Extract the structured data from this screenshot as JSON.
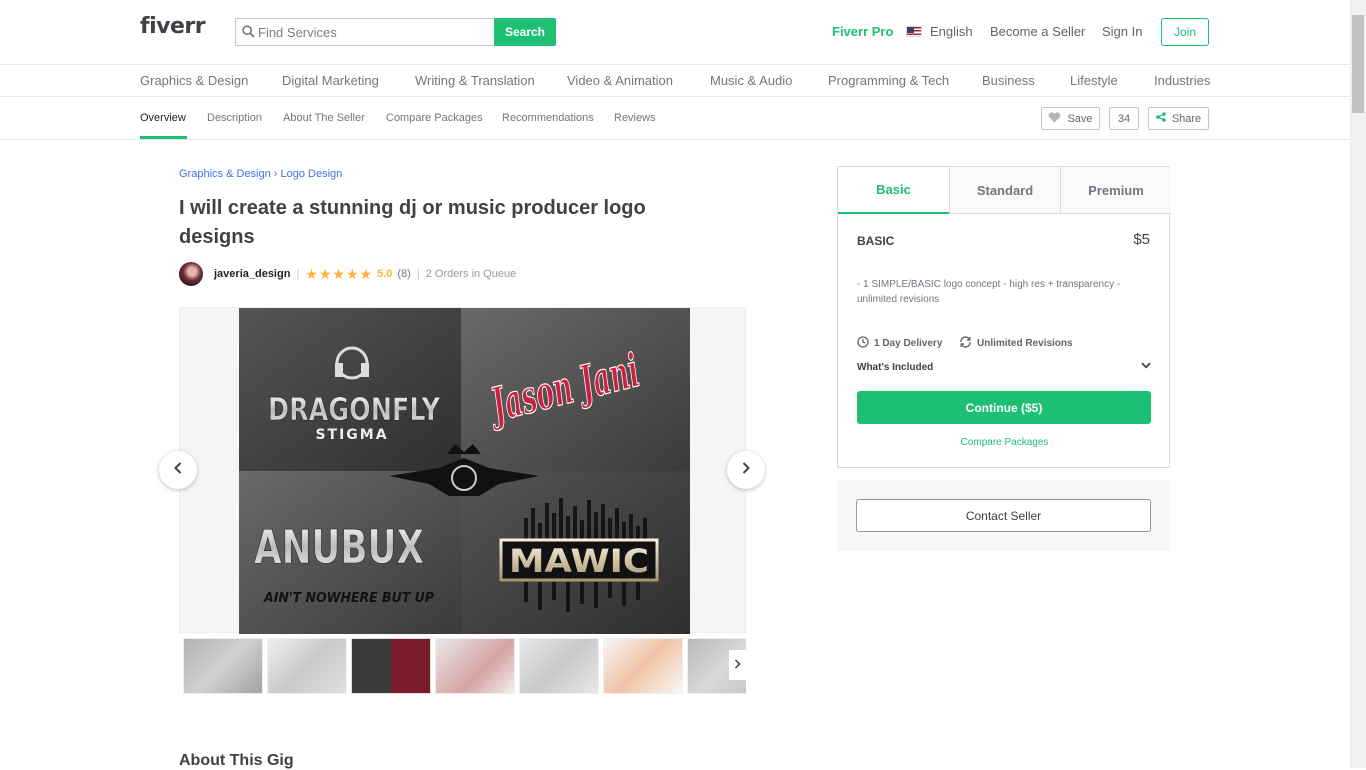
{
  "header": {
    "logo": "fiverr",
    "search_placeholder": "Find Services",
    "search_button": "Search",
    "fiverr_pro": "Fiverr Pro",
    "language": "English",
    "become_seller": "Become a Seller",
    "sign_in": "Sign In",
    "join": "Join"
  },
  "categories": [
    "Graphics & Design",
    "Digital Marketing",
    "Writing & Translation",
    "Video & Animation",
    "Music & Audio",
    "Programming & Tech",
    "Business",
    "Lifestyle",
    "Industries"
  ],
  "subnav": {
    "items": [
      "Overview",
      "Description",
      "About The Seller",
      "Compare Packages",
      "Recommendations",
      "Reviews"
    ],
    "active": "Overview",
    "save": "Save",
    "save_count": "34",
    "share": "Share"
  },
  "breadcrumb": {
    "category": "Graphics & Design",
    "separator": "›",
    "subcategory": "Logo Design"
  },
  "gig": {
    "title": "I will create a stunning dj or music producer logo designs",
    "seller": "javeria_design",
    "rating": "5.0",
    "rating_count": "(8)",
    "stars": 5,
    "queue": "2 Orders in Queue",
    "about_heading": "About This Gig"
  },
  "gallery": {
    "logos": [
      "DRAGONFLY",
      "STIGMA",
      "Jason Jani",
      "ANUBUX",
      "AIN'T NOWHERE BUT UP",
      "MAWIC"
    ],
    "thumbnail_count": 7,
    "active_thumbnail": 3
  },
  "package": {
    "tabs": [
      "Basic",
      "Standard",
      "Premium"
    ],
    "active_tab": "Basic",
    "name": "BASIC",
    "price": "$5",
    "description": "- 1 SIMPLE/BASIC logo concept - high res + transparency - unlimited revisions",
    "delivery": "1 Day Delivery",
    "revisions": "Unlimited Revisions",
    "whats_included": "What's Included",
    "continue": "Continue ($5)",
    "compare": "Compare Packages",
    "contact": "Contact Seller"
  },
  "colors": {
    "brand_green": "#1dbf73",
    "star": "#ffb33e",
    "link_blue": "#446ee7"
  }
}
